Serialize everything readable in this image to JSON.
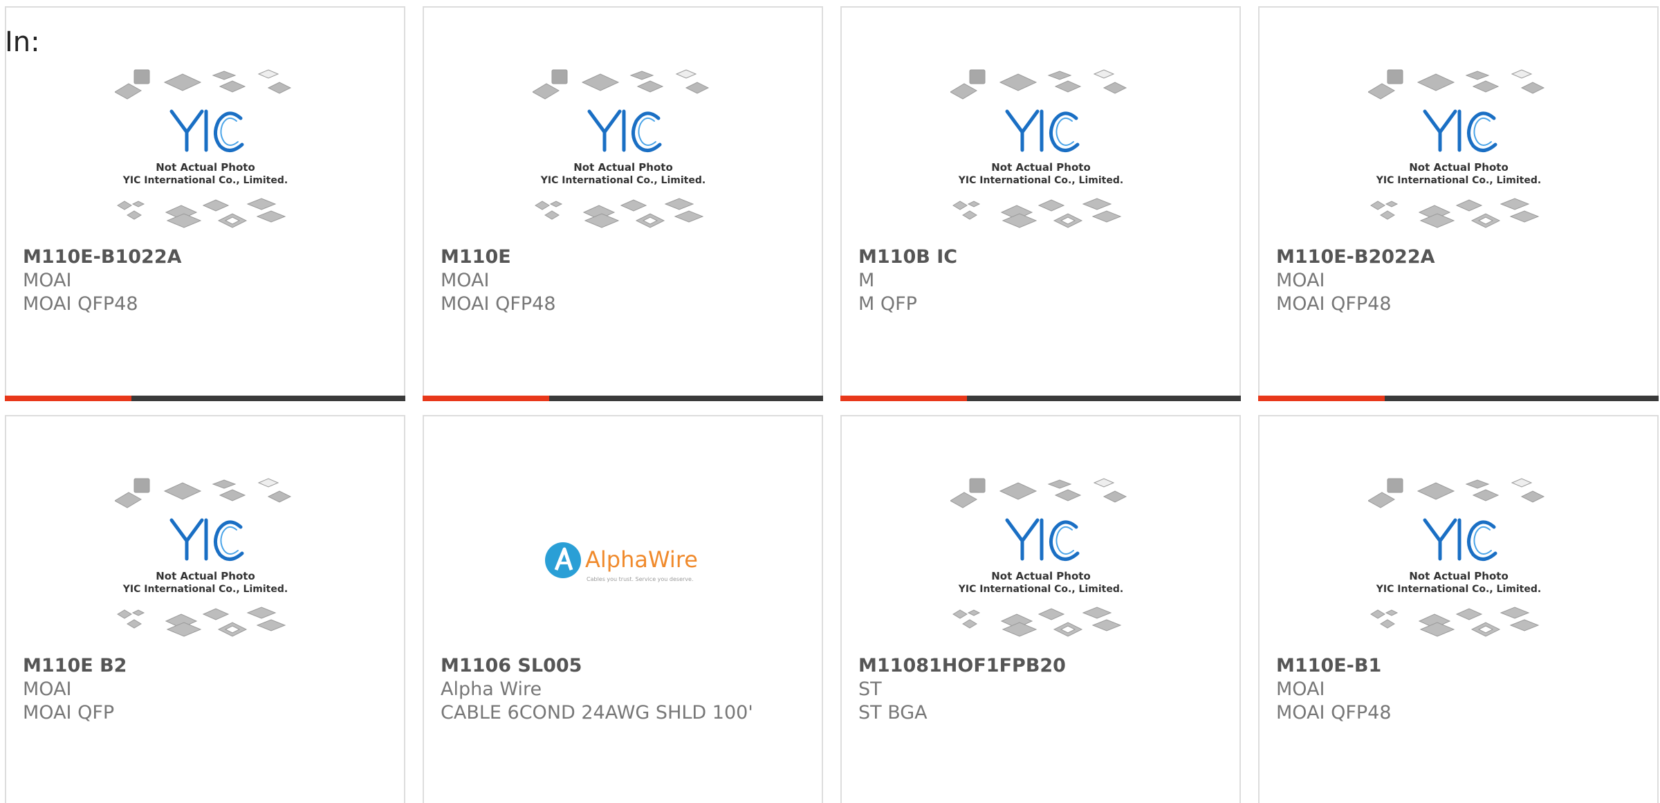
{
  "header_label": "In:",
  "placeholder": {
    "line1": "Not Actual Photo",
    "line2": "YIC International Co., Limited.",
    "logo_text": "YIC"
  },
  "alpha_logo": {
    "name": "AlphaWire",
    "tagline": "Cables you trust. Service you deserve."
  },
  "colors": {
    "accent": "#e8381a",
    "bar_dark": "#3a3a3a",
    "yic_blue": "#1a6fc4",
    "alpha_blue": "#2a9fd6",
    "alpha_orange": "#f08a2c"
  },
  "products": [
    {
      "part_no": "M110E-B1022A",
      "maker": "MOAI",
      "desc": "MOAI QFP48",
      "image": "yic"
    },
    {
      "part_no": "M110E",
      "maker": "MOAI",
      "desc": "MOAI QFP48",
      "image": "yic"
    },
    {
      "part_no": "M110B IC",
      "maker": "M",
      "desc": "M QFP",
      "image": "yic"
    },
    {
      "part_no": "M110E-B2022A",
      "maker": "MOAI",
      "desc": "MOAI QFP48",
      "image": "yic"
    },
    {
      "part_no": "M110E B2",
      "maker": "MOAI",
      "desc": "MOAI QFP",
      "image": "yic"
    },
    {
      "part_no": "M1106 SL005",
      "maker": "Alpha Wire",
      "desc": "CABLE 6COND 24AWG SHLD 100'",
      "image": "alpha"
    },
    {
      "part_no": "M11081HOF1FPB20",
      "maker": "ST",
      "desc": "ST BGA",
      "image": "yic"
    },
    {
      "part_no": "M110E-B1",
      "maker": "MOAI",
      "desc": "MOAI QFP48",
      "image": "yic"
    }
  ]
}
